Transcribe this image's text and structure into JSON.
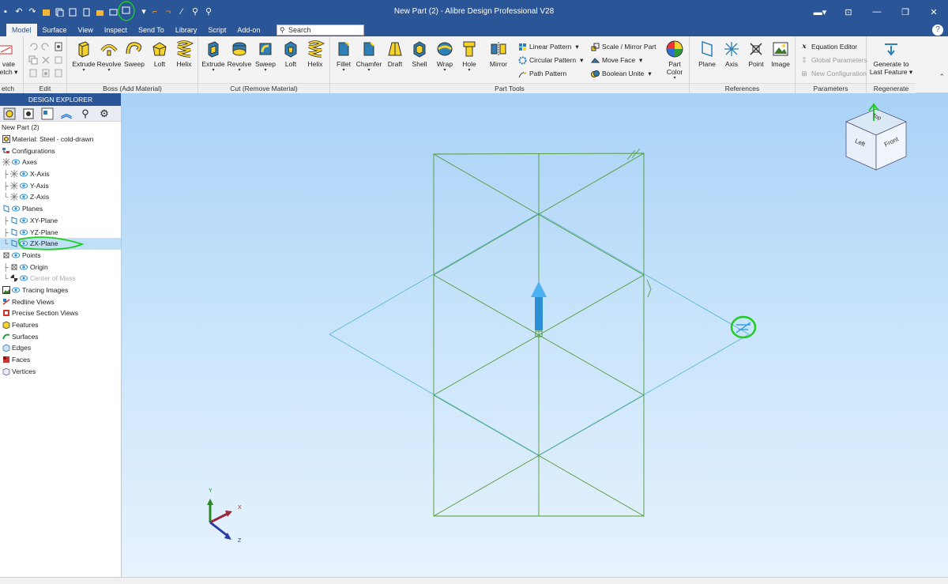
{
  "window": {
    "title": "New Part (2) - Alibre Design Professional V28"
  },
  "tabs": [
    "Model",
    "Surface",
    "View",
    "Inspect",
    "Send To",
    "Library",
    "Script",
    "Add-on"
  ],
  "active_tab": "Model",
  "search": {
    "placeholder": "Search"
  },
  "ribbon": {
    "groups": {
      "sketch": "etch",
      "edit": "Edit",
      "boss": "Boss (Add Material)",
      "cut": "Cut (Remove Material)",
      "parttools": "Part Tools",
      "references": "References",
      "parameters": "Parameters",
      "regenerate": "Regenerate"
    },
    "sketch_btn": {
      "line1": "vate",
      "line2": "etch ▾"
    },
    "boss": [
      "Extrude",
      "Revolve",
      "Sweep",
      "Loft",
      "Helix"
    ],
    "cut": [
      "Extrude",
      "Revolve",
      "Sweep",
      "Loft",
      "Helix"
    ],
    "parttools_big": [
      "Fillet",
      "Chamfer",
      "Draft",
      "Shell",
      "Wrap",
      "Hole",
      "Mirror"
    ],
    "pattern": [
      "Linear Pattern",
      "Circular Pattern",
      "Path Pattern"
    ],
    "modify": [
      "Scale / Mirror Part",
      "Move Face",
      "Boolean Unite"
    ],
    "partcolor": "Part Color",
    "refs": [
      "Plane",
      "Axis",
      "Point",
      "Image"
    ],
    "params": [
      "Equation Editor",
      "Global Parameters",
      "New Configuration"
    ],
    "regen": {
      "line1": "Generate to",
      "line2": "Last Feature ▾"
    }
  },
  "explorer": {
    "header": "DESIGN EXPLORER",
    "tree": [
      {
        "label": "New Part (2)",
        "level": 0,
        "icon": "none"
      },
      {
        "label": "Material: Steel - cold-drawn",
        "level": 0,
        "icon": "material"
      },
      {
        "label": "Configurations",
        "level": 0,
        "icon": "config"
      },
      {
        "label": "Axes",
        "level": 0,
        "icon": "axes",
        "eye": true
      },
      {
        "label": "X-Axis",
        "level": 1,
        "icon": "axes",
        "eye": true
      },
      {
        "label": "Y-Axis",
        "level": 1,
        "icon": "axes",
        "eye": true
      },
      {
        "label": "Z-Axis",
        "level": 1,
        "icon": "axes",
        "eye": true
      },
      {
        "label": "Planes",
        "level": 0,
        "icon": "plane",
        "eye": true
      },
      {
        "label": "XY-Plane",
        "level": 1,
        "icon": "plane",
        "eye": true
      },
      {
        "label": "YZ-Plane",
        "level": 1,
        "icon": "plane",
        "eye": true
      },
      {
        "label": "ZX-Plane",
        "level": 1,
        "icon": "plane",
        "eye": true,
        "selected": true
      },
      {
        "label": "Points",
        "level": 0,
        "icon": "point",
        "eye": true
      },
      {
        "label": "Origin",
        "level": 1,
        "icon": "point",
        "eye": true
      },
      {
        "label": "Center of Mass",
        "level": 1,
        "icon": "com",
        "eye": true,
        "dim": true
      },
      {
        "label": "Tracing Images",
        "level": 0,
        "icon": "image",
        "eye": true
      },
      {
        "label": "Redline Views",
        "level": 0,
        "icon": "redline"
      },
      {
        "label": "Precise Section Views",
        "level": 0,
        "icon": "section"
      },
      {
        "label": "Features",
        "level": 0,
        "icon": "features"
      },
      {
        "label": "Surfaces",
        "level": 0,
        "icon": "surfaces"
      },
      {
        "label": "Edges",
        "level": 0,
        "icon": "edges"
      },
      {
        "label": "Faces",
        "level": 0,
        "icon": "faces"
      },
      {
        "label": "Vertices",
        "level": 0,
        "icon": "vertices"
      }
    ]
  },
  "viewcube": {
    "top": "Top",
    "left": "Left",
    "front": "Front"
  },
  "triad": {
    "x": "X",
    "y": "Y",
    "z": "Z"
  },
  "colors": {
    "accent": "#2a5597",
    "plane_green": "#3f8f2a",
    "annotation_green": "#22cc22",
    "selection": "#bfe0f7"
  }
}
